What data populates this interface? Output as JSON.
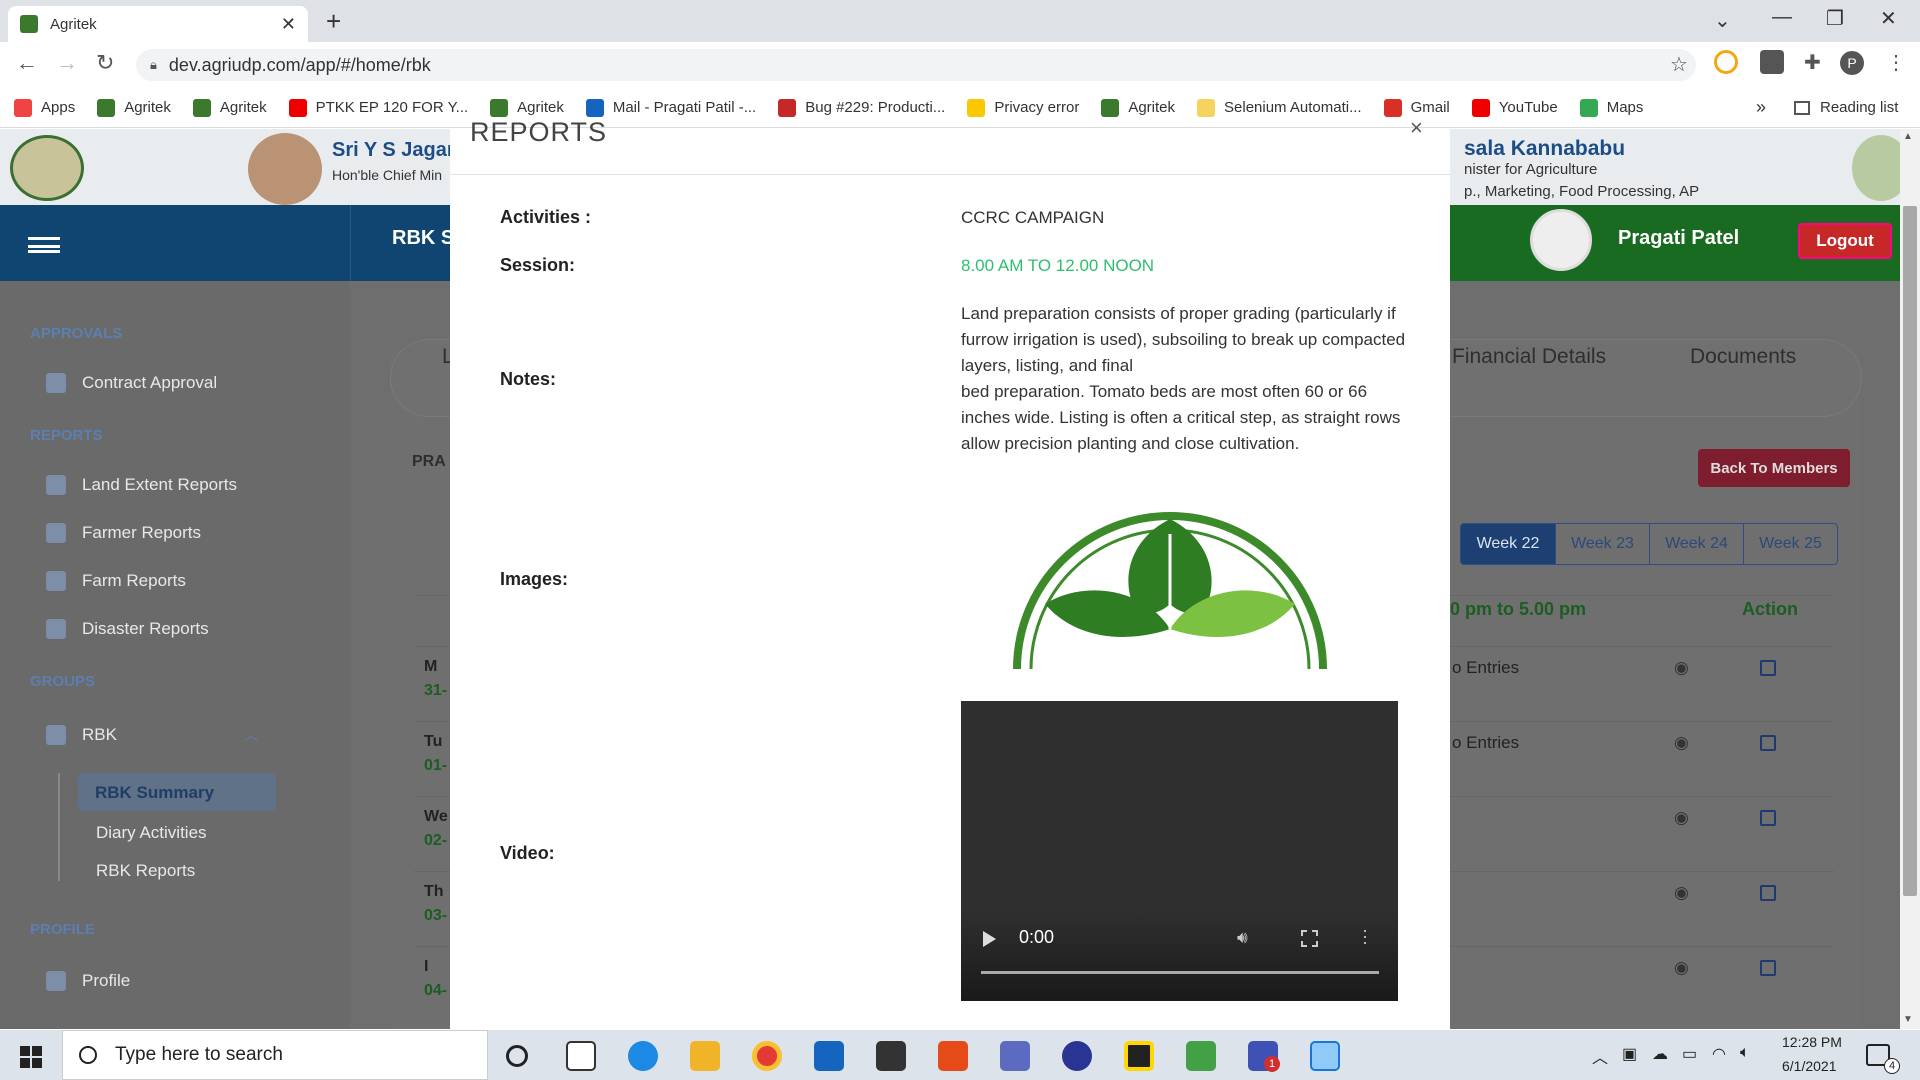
{
  "browser": {
    "tab_title": "Agritek",
    "tab_close": "✕",
    "new_tab": "+",
    "url": "dev.agriudp.com/app/#/home/rbk",
    "profile_initial": "P",
    "bookmarks": [
      {
        "label": "Apps",
        "icon": "apps-grid-icon",
        "color": "#e44"
      },
      {
        "label": "Agritek",
        "icon": "agritek-icon",
        "color": "#3b7a2c"
      },
      {
        "label": "Agritek",
        "icon": "agritek-icon",
        "color": "#3b7a2c"
      },
      {
        "label": "PTKK EP 120 FOR Y...",
        "icon": "youtube-icon",
        "color": "#e00"
      },
      {
        "label": "Agritek",
        "icon": "agritek-icon",
        "color": "#3b7a2c"
      },
      {
        "label": "Mail - Pragati Patil -...",
        "icon": "outlook-icon",
        "color": "#1565c0"
      },
      {
        "label": "Bug #229: Producti...",
        "icon": "bug-icon",
        "color": "#c62828"
      },
      {
        "label": "Privacy error",
        "icon": "warning-icon",
        "color": "#f9c800"
      },
      {
        "label": "Agritek",
        "icon": "agritek-icon",
        "color": "#3b7a2c"
      },
      {
        "label": "Selenium Automati...",
        "icon": "folder-icon",
        "color": "#f4d35e"
      },
      {
        "label": "Gmail",
        "icon": "gmail-icon",
        "color": "#d93025"
      },
      {
        "label": "YouTube",
        "icon": "youtube-icon",
        "color": "#e00"
      },
      {
        "label": "Maps",
        "icon": "maps-icon",
        "color": "#34a853"
      }
    ],
    "overflow": "»",
    "reading_list": "Reading list"
  },
  "header": {
    "cm_name": "Sri Y S Jagan",
    "cm_role": "Hon'ble Chief Min",
    "minister_name": "sala Kannababu",
    "minister_role1": "nister for Agriculture",
    "minister_role2": "p., Marketing, Food Processing, AP",
    "app_title": "RBK S",
    "user_name": "Pragati Patel",
    "logout_label": "Logout"
  },
  "sidebar": {
    "approvals": "APPROVALS",
    "contract_approval": "Contract Approval",
    "reports": "REPORTS",
    "land_extent": "Land Extent Reports",
    "farmer_reports": "Farmer Reports",
    "farm_reports": "Farm Reports",
    "disaster_reports": "Disaster Reports",
    "groups": "GROUPS",
    "rbk": "RBK",
    "rbk_summary": "RBK Summary",
    "diary_activities": "Diary Activities",
    "rbk_reports": "RBK Reports",
    "profile_section": "PROFILE",
    "profile": "Profile"
  },
  "main": {
    "tab_l": "L",
    "financial_details": "Financial Details",
    "documents": "Documents",
    "section_prefix": "PRA",
    "back_to_members": "Back To Members",
    "weeks": [
      "Week 22",
      "Week 23",
      "Week 24",
      "Week 25"
    ],
    "col_time": "0 pm to 5.00 pm",
    "col_action": "Action",
    "rows": [
      {
        "day": "M",
        "date": "31-",
        "entries": "o Entries"
      },
      {
        "day": "Tu",
        "date": "01-",
        "entries": "o Entries"
      },
      {
        "day": "We",
        "date": "02-",
        "entries": ""
      },
      {
        "day": "Th",
        "date": "03-",
        "entries": ""
      },
      {
        "day": "I",
        "date": "04-",
        "entries": ""
      }
    ]
  },
  "modal": {
    "title": "REPORTS",
    "close": "×",
    "activities_label": "Activities :",
    "activities_value": "CCRC CAMPAIGN",
    "session_label": "Session:",
    "session_value": "8.00 AM TO 12.00 NOON",
    "notes_label": "Notes:",
    "notes_line1": "Land preparation consists of proper grading (particularly if furrow irrigation is used), subsoiling to break up compacted layers, listing, and final",
    "notes_line2": "bed preparation. Tomato beds are most often 60 or 66 inches wide. Listing is often a critical step, as straight rows allow precision planting and close cultivation.",
    "images_label": "Images:",
    "video_label": "Video:",
    "video_time": "0:00"
  },
  "taskbar": {
    "search_placeholder": "Type here to search",
    "time": "12:28 PM",
    "date": "6/1/2021",
    "notifications": "4",
    "teams_badge": "1"
  },
  "colors": {
    "session_green": "#2ebf6e",
    "brand_blue": "#0f4570",
    "brand_green": "#1a6b22"
  }
}
